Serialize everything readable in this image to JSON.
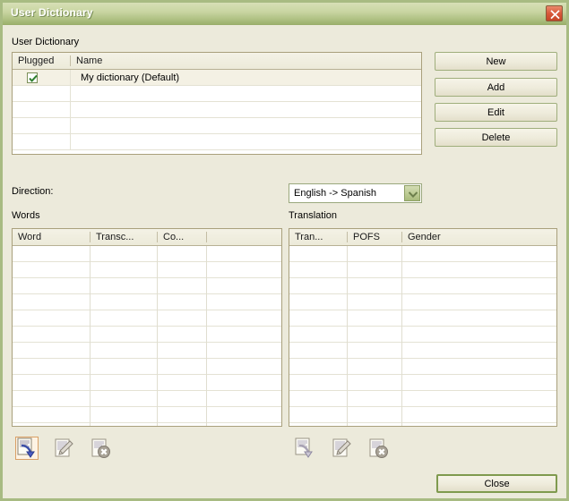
{
  "window": {
    "title": "User Dictionary",
    "close_icon": "close-icon",
    "close_tooltip": "Close"
  },
  "dictionary_section": {
    "label": "User Dictionary",
    "columns": [
      "Plugged",
      "Name"
    ],
    "rows": [
      {
        "plugged": true,
        "name": "My dictionary (Default)"
      }
    ],
    "empty_row_count": 4,
    "buttons": [
      {
        "id": "new",
        "label": "New"
      },
      {
        "id": "add",
        "label": "Add"
      },
      {
        "id": "edit",
        "label": "Edit"
      },
      {
        "id": "delete",
        "label": "Delete"
      }
    ]
  },
  "direction": {
    "label": "Direction:",
    "value": "English -> Spanish",
    "arrow_icon": "chevron-down-icon"
  },
  "words_panel": {
    "label": "Words",
    "columns": [
      "Word",
      "Transc...",
      "Co...",
      ""
    ],
    "rows": [],
    "empty_row_count": 11,
    "tools": [
      {
        "id": "add-word",
        "icon": "document-add-arrow-icon",
        "enabled": true,
        "label": "Add word"
      },
      {
        "id": "edit-word",
        "icon": "document-pencil-icon",
        "enabled": false,
        "label": "Edit word"
      },
      {
        "id": "delete-word",
        "icon": "document-delete-icon",
        "enabled": false,
        "label": "Delete word"
      }
    ]
  },
  "translation_panel": {
    "label": "Translation",
    "columns": [
      "Tran...",
      "POFS",
      "Gender"
    ],
    "rows": [],
    "empty_row_count": 11,
    "tools": [
      {
        "id": "add-translation",
        "icon": "document-add-arrow-icon",
        "enabled": false,
        "label": "Add translation"
      },
      {
        "id": "edit-translation",
        "icon": "document-pencil-icon",
        "enabled": false,
        "label": "Edit translation"
      },
      {
        "id": "delete-translation",
        "icon": "document-delete-icon",
        "enabled": false,
        "label": "Delete translation"
      }
    ]
  },
  "footer": {
    "close_label": "Close"
  },
  "colors": {
    "title_bar_light": "#d7e0b6",
    "title_bar_dark": "#9cb16d",
    "dialog_background": "#eceadb",
    "border_green": "#a8bb82",
    "close_button_red": "#d8583a",
    "check_green": "#2f7f2f",
    "accent_blue": "#3d4fa8",
    "default_button_border": "#7f9a4e"
  }
}
